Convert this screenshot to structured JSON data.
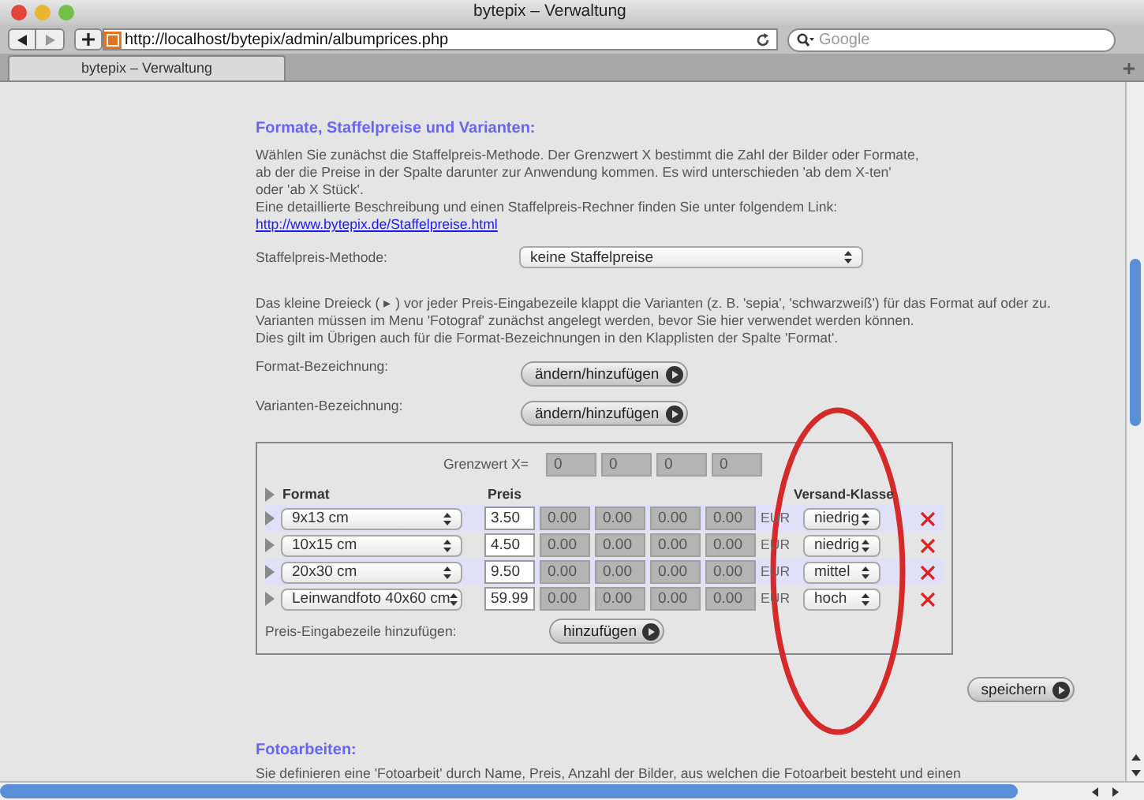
{
  "window": {
    "title": "bytepix – Verwaltung"
  },
  "toolbar": {
    "url": "http://localhost/bytepix/admin/albumprices.php",
    "search": {
      "placeholder": "Google"
    }
  },
  "tabs": [
    {
      "label": "bytepix – Verwaltung",
      "selected": true
    }
  ],
  "section": {
    "heading": "Formate, Staffelpreise und Varianten:",
    "intro": [
      "Wählen Sie zunächst die Staffelpreis-Methode. Der Grenzwert X bestimmt die Zahl der Bilder oder Formate,",
      "ab der die Preise in der Spalte darunter zur Anwendung kommen. Es wird unterschieden 'ab dem X-ten'",
      "oder 'ab X Stück'.",
      "Eine detaillierte Beschreibung und einen Staffelpreis-Rechner finden Sie unter folgendem Link:"
    ],
    "link": "http://www.bytepix.de/Staffelpreise.html",
    "method": {
      "label": "Staffelpreis-Methode:",
      "value": "keine Staffelpreise"
    },
    "info": [
      "Das kleine Dreieck ( ▸ ) vor jeder Preis-Eingabezeile klappt die Varianten (z. B. 'sepia', 'schwarzweiß') für das Format auf oder zu.",
      "Varianten müssen im Menu 'Fotograf' zunächst angelegt werden, bevor Sie hier verwendet werden können.",
      "Dies gilt im Übrigen auch für die Format-Bezeichnungen in den Klapplisten der Spalte 'Format'."
    ],
    "actions": [
      {
        "label": "Format-Bezeichnung:",
        "button": "ändern/hinzufügen"
      },
      {
        "label": "Varianten-Bezeichnung:",
        "button": "ändern/hinzufügen"
      }
    ]
  },
  "table": {
    "threshold_label": "Grenzwert X=",
    "thresholds": [
      "0",
      "0",
      "0",
      "0"
    ],
    "columns": [
      "Format",
      "Preis",
      "Versand-Klasse"
    ],
    "rows": [
      {
        "format": "9x13 cm",
        "price": "3.50",
        "tiers": [
          "0.00",
          "0.00",
          "0.00",
          "0.00"
        ],
        "currency": "EUR",
        "shipping": "niedrig"
      },
      {
        "format": "10x15 cm",
        "price": "4.50",
        "tiers": [
          "0.00",
          "0.00",
          "0.00",
          "0.00"
        ],
        "currency": "EUR",
        "shipping": "niedrig"
      },
      {
        "format": "20x30 cm",
        "price": "9.50",
        "tiers": [
          "0.00",
          "0.00",
          "0.00",
          "0.00"
        ],
        "currency": "EUR",
        "shipping": "mittel"
      },
      {
        "format": "Leinwandfoto 40x60 cm",
        "price": "59.99",
        "tiers": [
          "0.00",
          "0.00",
          "0.00",
          "0.00"
        ],
        "currency": "EUR",
        "shipping": "hoch"
      }
    ],
    "add_label": "Preis-Eingabezeile hinzufügen:",
    "add_button": "hinzufügen"
  },
  "save_button": "speichern",
  "section2": {
    "heading": "Fotoarbeiten:",
    "text": "Sie definieren eine 'Fotoarbeit' durch Name, Preis, Anzahl der Bilder, aus welchen die Fotoarbeit besteht und einen"
  }
}
